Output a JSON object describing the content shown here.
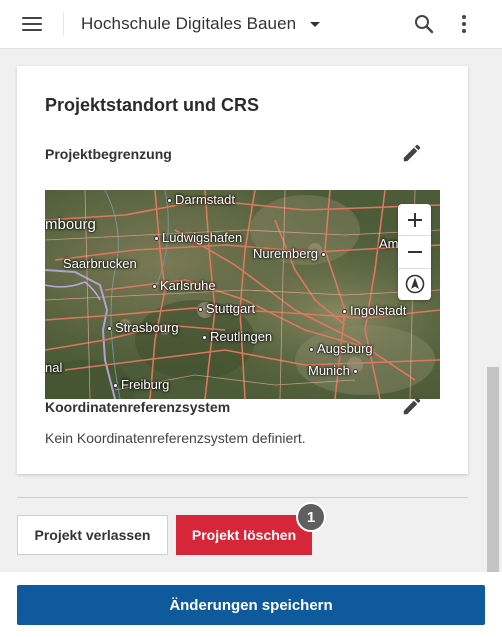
{
  "appbar": {
    "project_title": "Hochschule Digitales Bauen",
    "icons": [
      "menu-icon",
      "chevron-down-icon",
      "search-icon",
      "more-vert-icon"
    ]
  },
  "card": {
    "title": "Projektstandort und CRS",
    "boundary_label": "Projektbegrenzung",
    "crs_label": "Koordinatenreferenzsystem",
    "crs_value": "Kein Koordinatenreferenzsystem definiert."
  },
  "map": {
    "cities": [
      {
        "name": "Darmstadt"
      },
      {
        "name": "mbourg"
      },
      {
        "name": "Ludwigshafen"
      },
      {
        "name": "Saarbrucken"
      },
      {
        "name": "Nuremberg"
      },
      {
        "name": "Am"
      },
      {
        "name": "Karlsruhe"
      },
      {
        "name": "Stuttgart"
      },
      {
        "name": "Ingolstadt"
      },
      {
        "name": "Strasbourg"
      },
      {
        "name": "Reutlingen"
      },
      {
        "name": "Augsburg"
      },
      {
        "name": "Munich"
      },
      {
        "name": "nal"
      },
      {
        "name": "Freiburg"
      }
    ],
    "controls": [
      "zoom-in-icon",
      "zoom-out-icon",
      "compass-icon"
    ]
  },
  "actions": {
    "leave_label": "Projekt verlassen",
    "delete_label": "Projekt löschen",
    "badge_count": "1",
    "save_label": "Änderungen speichern"
  },
  "colors": {
    "primary": "#0f5a9c",
    "danger": "#d7263a",
    "badge": "#5f5f5f"
  }
}
